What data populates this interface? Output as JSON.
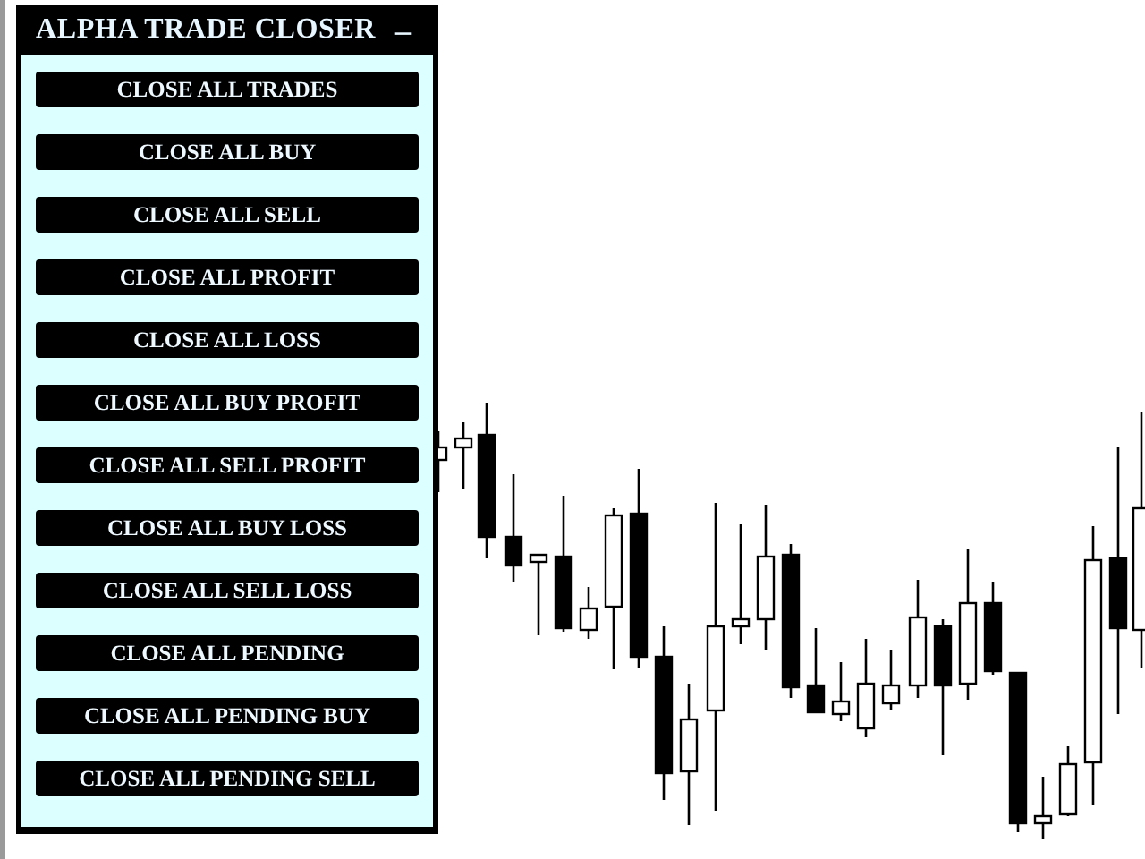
{
  "panel": {
    "title": "ALPHA TRADE CLOSER",
    "minimize": "–"
  },
  "buttons": [
    "CLOSE ALL TRADES",
    "CLOSE ALL BUY",
    "CLOSE ALL SELL",
    "CLOSE ALL PROFIT",
    "CLOSE ALL LOSS",
    "CLOSE ALL BUY PROFIT",
    "CLOSE ALL SELL PROFIT",
    "CLOSE ALL BUY LOSS",
    "CLOSE ALL SELL LOSS",
    "CLOSE ALL PENDING",
    "CLOSE ALL PENDING BUY",
    "CLOSE ALL PENDING SELL"
  ]
}
